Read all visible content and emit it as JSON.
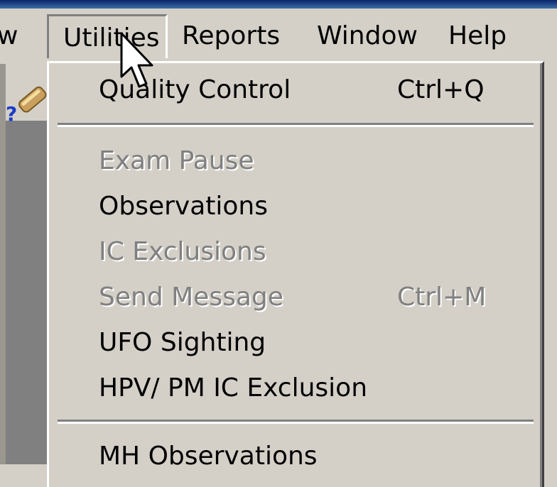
{
  "menubar": {
    "partial_label": "w",
    "items": [
      "Utilities",
      "Reports",
      "Window",
      "Help"
    ]
  },
  "dropdown": {
    "items": [
      {
        "label": "Quality Control",
        "shortcut": "Ctrl+Q",
        "enabled": true
      },
      {
        "label": "Exam Pause",
        "shortcut": "",
        "enabled": false
      },
      {
        "label": "Observations",
        "shortcut": "",
        "enabled": true
      },
      {
        "label": "IC Exclusions",
        "shortcut": "",
        "enabled": false
      },
      {
        "label": "Send Message",
        "shortcut": "Ctrl+M",
        "enabled": false
      },
      {
        "label": "UFO Sighting",
        "shortcut": "",
        "enabled": true
      },
      {
        "label": "HPV/ PM IC Exclusion",
        "shortcut": "",
        "enabled": true
      },
      {
        "label": "MH Observations",
        "shortcut": "",
        "enabled": true
      }
    ]
  },
  "icons": {
    "toolbar": "help-pointer-icon",
    "cursor": "mouse-pointer-icon"
  }
}
